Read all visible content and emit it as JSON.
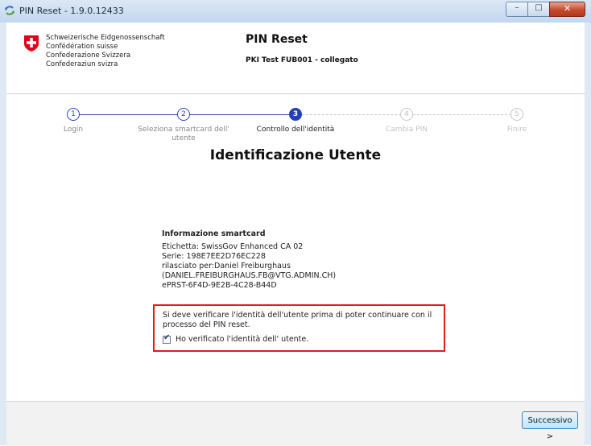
{
  "window": {
    "title": "PIN Reset - 1.9.0.12433",
    "controls": {
      "minimize": "–",
      "maximize": "□",
      "close": "✕"
    }
  },
  "header": {
    "gov_lines": [
      "Schweizerische Eidgenossenschaft",
      "Confédération suisse",
      "Confederazione Svizzera",
      "Confederaziun svizra"
    ],
    "app_title": "PIN Reset",
    "app_subtitle": "PKI Test FUB001 - collegato"
  },
  "steps": [
    {
      "number": "1",
      "label": "Login",
      "state": "done"
    },
    {
      "number": "2",
      "label": "Seleziona smartcard dell' utente",
      "state": "done"
    },
    {
      "number": "3",
      "label": "Controllo dell'identità",
      "state": "active"
    },
    {
      "number": "4",
      "label": "Cambia PIN",
      "state": "todo"
    },
    {
      "number": "5",
      "label": "Finire",
      "state": "todo"
    }
  ],
  "main": {
    "heading": "Identificazione Utente",
    "info": {
      "title": "Informazione smartcard",
      "lines": [
        "Etichetta: SwissGov Enhanced CA 02",
        "Serie: 198E7EE2D76EC228",
        "rilasciato per:Daniel Freiburghaus",
        "(DANIEL.FREIBURGHAUS.FB@VTG.ADMIN.CH)",
        "ePRST-6F4D-9E2B-4C28-B44D"
      ]
    },
    "verification": {
      "text": "Si deve verificare l'identità dell'utente prima di poter continuare con il processo del PIN reset.",
      "checkbox_label": "Ho verificato l'identità dell' utente.",
      "checked": true
    }
  },
  "footer": {
    "next_label": "Successivo >"
  },
  "colors": {
    "accent": "#2440b0",
    "highlight_border": "#e21b1b"
  }
}
